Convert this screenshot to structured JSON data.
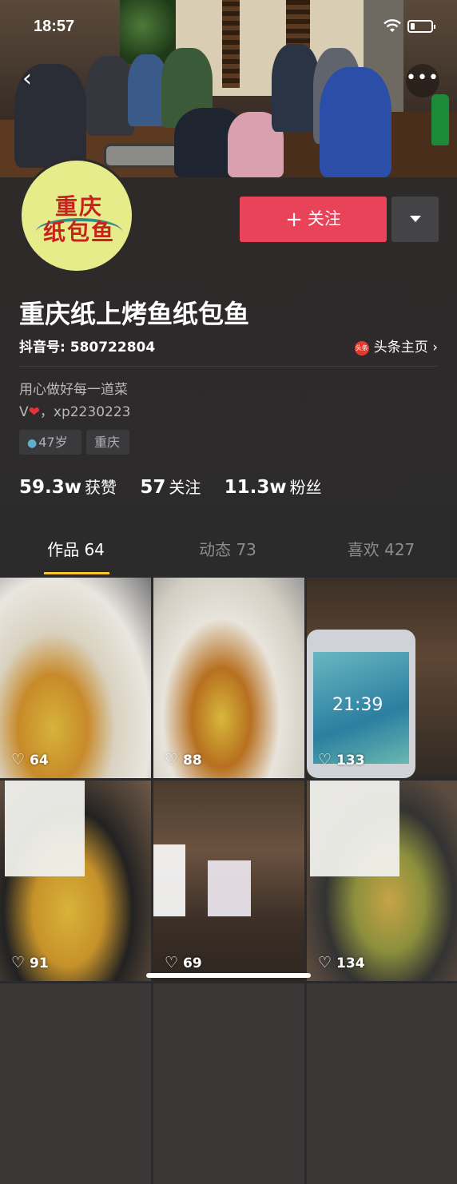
{
  "status_bar": {
    "time": "18:57"
  },
  "profile": {
    "avatar_text_line1": "重庆",
    "avatar_text_line2": "纸包鱼",
    "follow_label": "关注",
    "name": "重庆纸上烤鱼纸包鱼",
    "douyin_id": "抖音号: 580722804",
    "toutiao_badge": "头条",
    "toutiao_link": "头条主页 ›",
    "bio_line1": "用心做好每一道菜",
    "bio_line2_prefix": "V",
    "bio_line2_suffix": "，xp2230223",
    "tags": {
      "age": "47岁",
      "city": "重庆"
    },
    "stats": {
      "likes_value": "59.3w",
      "likes_label": "获赞",
      "following_value": "57",
      "following_label": "关注",
      "fans_value": "11.3w",
      "fans_label": "粉丝"
    }
  },
  "tabs": [
    {
      "label": "作品 64",
      "active": true
    },
    {
      "label": "动态 73",
      "active": false
    },
    {
      "label": "喜欢 427",
      "active": false
    }
  ],
  "videos": [
    {
      "likes": "64"
    },
    {
      "likes": "88"
    },
    {
      "likes": "133",
      "phone_time": "21:39"
    },
    {
      "likes": "91"
    },
    {
      "likes": "69"
    },
    {
      "likes": "134"
    }
  ],
  "icons": {
    "back": "back-chevron-icon",
    "more": "more-dots-icon",
    "heart": "heart-outline-icon"
  },
  "colors": {
    "follow_button": "#e9435a",
    "tab_underline": "#f7c42f",
    "avatar_bg": "#e7ec8a",
    "avatar_text": "#c6231f"
  }
}
